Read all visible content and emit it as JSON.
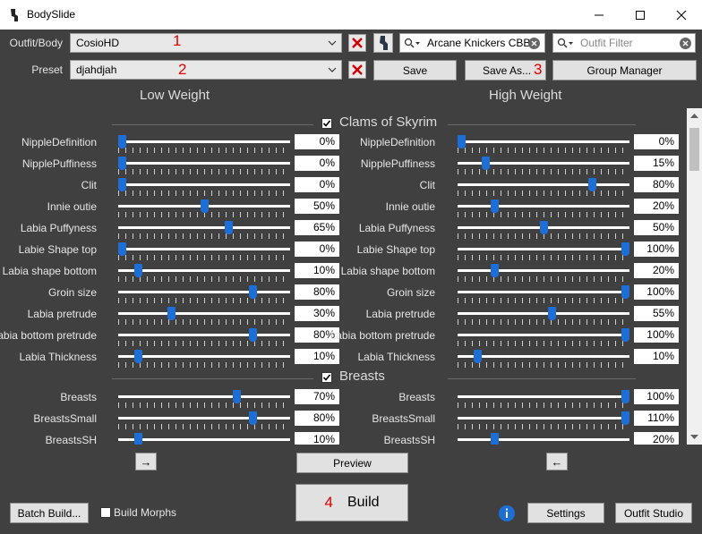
{
  "window": {
    "title": "BodySlide"
  },
  "outfit": {
    "label": "Outfit/Body",
    "value": "CosioHD",
    "annotation": "1"
  },
  "preset": {
    "label": "Preset",
    "value": "djahdjah",
    "annotation": "2"
  },
  "search": {
    "outfit_search_value": "Arcane Knickers CBB",
    "outfit_filter_placeholder": "Outfit Filter"
  },
  "buttons": {
    "save": "Save",
    "save_as": "Save As...",
    "save_as_annotation": "3",
    "group_manager": "Group Manager",
    "preview": "Preview",
    "build": "Build",
    "build_annotation": "4",
    "batch_build": "Batch Build...",
    "build_morphs": "Build Morphs",
    "settings": "Settings",
    "outfit_studio": "Outfit Studio",
    "copy_right": "→",
    "copy_left": "←"
  },
  "headers": {
    "low": "Low Weight",
    "high": "High Weight"
  },
  "categories": [
    {
      "name": "Clams of Skyrim",
      "checked": true
    },
    {
      "name": "Breasts",
      "checked": true
    }
  ],
  "sliders": [
    {
      "name": "NippleDefinition",
      "low": 0,
      "high": 0
    },
    {
      "name": "NipplePuffiness",
      "low": 0,
      "high": 15
    },
    {
      "name": "Clit",
      "low": 0,
      "high": 80
    },
    {
      "name": "Innie outie",
      "low": 50,
      "high": 20
    },
    {
      "name": "Labia Puffyness",
      "low": 65,
      "high": 50
    },
    {
      "name": "Labie Shape top",
      "low": 0,
      "high": 100
    },
    {
      "name": "Labia shape bottom",
      "low": 10,
      "high": 20
    },
    {
      "name": "Groin size",
      "low": 80,
      "high": 100
    },
    {
      "name": "Labia pretrude",
      "low": 30,
      "high": 55
    },
    {
      "name": "Labia bottom pretrude",
      "low": 80,
      "high": 100
    },
    {
      "name": "Labia Thickness",
      "low": 10,
      "high": 10
    },
    {
      "name": "Breasts",
      "low": 70,
      "high": 100
    },
    {
      "name": "BreastsSmall",
      "low": 80,
      "high": 110
    },
    {
      "name": "BreastsSH",
      "low": 10,
      "high": 20
    }
  ],
  "colors": {
    "accent": "#1d6fd6",
    "annotation": "#e00000",
    "background": "#404040"
  }
}
